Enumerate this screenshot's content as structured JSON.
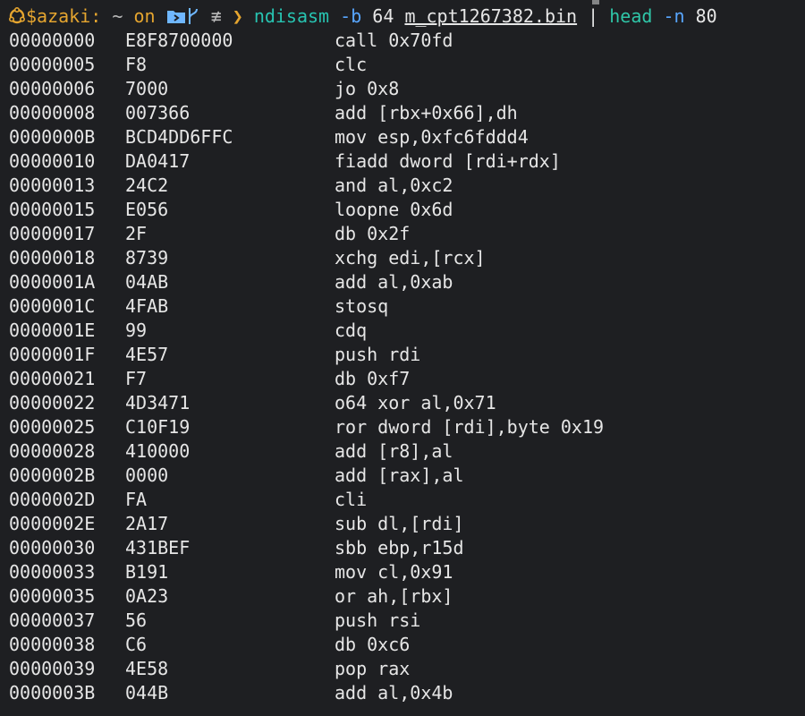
{
  "prompt": {
    "user": "$azaki:",
    "path": "~",
    "on_label": "on",
    "git_status": "≢",
    "arrow": "❯",
    "command": "ndisasm",
    "flag_b": "-b",
    "arg_64": "64",
    "filename": "m_cpt1267382.bin",
    "pipe": "|",
    "head_cmd": "head",
    "flag_n": "-n",
    "arg_80": "80"
  },
  "icons": {
    "distro": "ubuntu-icon",
    "folder": "folder-icon",
    "branch": "git-branch-icon"
  },
  "colors": {
    "background": "#1e1f22",
    "user": "#e5a52f",
    "command": "#27c3b1",
    "flag": "#58a6ff"
  },
  "disassembly": [
    {
      "addr": "00000000",
      "hex": "E8F8700000",
      "asm": "call 0x70fd"
    },
    {
      "addr": "00000005",
      "hex": "F8",
      "asm": "clc"
    },
    {
      "addr": "00000006",
      "hex": "7000",
      "asm": "jo 0x8"
    },
    {
      "addr": "00000008",
      "hex": "007366",
      "asm": "add [rbx+0x66],dh"
    },
    {
      "addr": "0000000B",
      "hex": "BCD4DD6FFC",
      "asm": "mov esp,0xfc6fddd4"
    },
    {
      "addr": "00000010",
      "hex": "DA0417",
      "asm": "fiadd dword [rdi+rdx]"
    },
    {
      "addr": "00000013",
      "hex": "24C2",
      "asm": "and al,0xc2"
    },
    {
      "addr": "00000015",
      "hex": "E056",
      "asm": "loopne 0x6d"
    },
    {
      "addr": "00000017",
      "hex": "2F",
      "asm": "db 0x2f"
    },
    {
      "addr": "00000018",
      "hex": "8739",
      "asm": "xchg edi,[rcx]"
    },
    {
      "addr": "0000001A",
      "hex": "04AB",
      "asm": "add al,0xab"
    },
    {
      "addr": "0000001C",
      "hex": "4FAB",
      "asm": "stosq"
    },
    {
      "addr": "0000001E",
      "hex": "99",
      "asm": "cdq"
    },
    {
      "addr": "0000001F",
      "hex": "4E57",
      "asm": "push rdi"
    },
    {
      "addr": "00000021",
      "hex": "F7",
      "asm": "db 0xf7"
    },
    {
      "addr": "00000022",
      "hex": "4D3471",
      "asm": "o64 xor al,0x71"
    },
    {
      "addr": "00000025",
      "hex": "C10F19",
      "asm": "ror dword [rdi],byte 0x19"
    },
    {
      "addr": "00000028",
      "hex": "410000",
      "asm": "add [r8],al"
    },
    {
      "addr": "0000002B",
      "hex": "0000",
      "asm": "add [rax],al"
    },
    {
      "addr": "0000002D",
      "hex": "FA",
      "asm": "cli"
    },
    {
      "addr": "0000002E",
      "hex": "2A17",
      "asm": "sub dl,[rdi]"
    },
    {
      "addr": "00000030",
      "hex": "431BEF",
      "asm": "sbb ebp,r15d"
    },
    {
      "addr": "00000033",
      "hex": "B191",
      "asm": "mov cl,0x91"
    },
    {
      "addr": "00000035",
      "hex": "0A23",
      "asm": "or ah,[rbx]"
    },
    {
      "addr": "00000037",
      "hex": "56",
      "asm": "push rsi"
    },
    {
      "addr": "00000038",
      "hex": "C6",
      "asm": "db 0xc6"
    },
    {
      "addr": "00000039",
      "hex": "4E58",
      "asm": "pop rax"
    },
    {
      "addr": "0000003B",
      "hex": "044B",
      "asm": "add al,0x4b"
    }
  ]
}
